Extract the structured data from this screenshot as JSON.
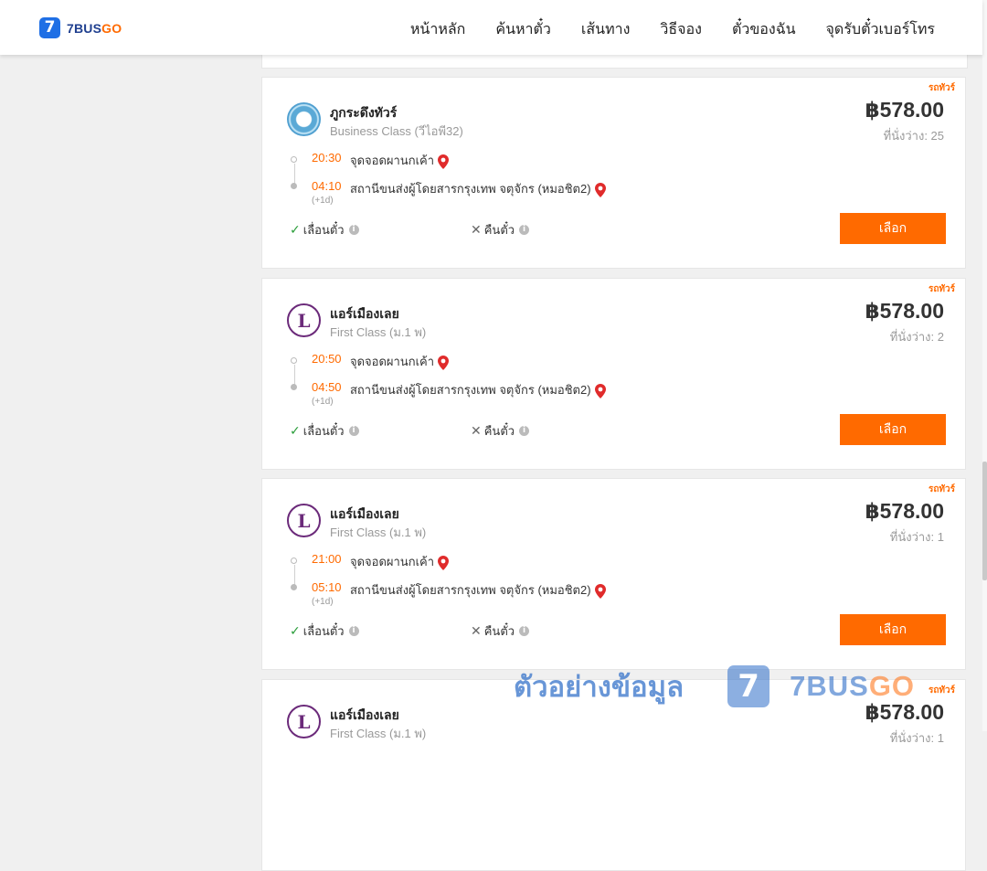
{
  "header": {
    "logo_digit": "7",
    "logo_text_a": "7BUS",
    "logo_text_b": "GO",
    "nav": [
      "หน้าหลัก",
      "ค้นหาตั๋ว",
      "เส้นทาง",
      "วิธีจอง",
      "ตั๋วของฉัน",
      "จุดรับตั๋วเบอร์โทร"
    ]
  },
  "trips": [
    {
      "tag": "รถทัวร์",
      "operator": "ภูกระดึงทัวร์",
      "class": "Business Class (วีไอพี32)",
      "logo_icon": "phukradueng-logo",
      "price": "฿578.00",
      "seats": "ที่นั่งว่าง: 25",
      "dep_time": "20:30",
      "dep_place": "จุดจอดผานกเค้า",
      "arr_time": "04:10",
      "arr_place": "สถานีขนส่งผู้โดยสารกรุงเทพ จตุจักร (หมอชิต2)",
      "next_day": "(+1d)",
      "change": "เลื่อนตั๋ว",
      "refund": "คืนตั๋ว",
      "button": "เลือก"
    },
    {
      "tag": "รถทัวร์",
      "operator": "แอร์เมืองเลย",
      "class": "First Class (ม.1 พ)",
      "logo_icon": "air-mueang-loei-logo",
      "price": "฿578.00",
      "seats": "ที่นั่งว่าง: 2",
      "dep_time": "20:50",
      "dep_place": "จุดจอดผานกเค้า",
      "arr_time": "04:50",
      "arr_place": "สถานีขนส่งผู้โดยสารกรุงเทพ จตุจักร (หมอชิต2)",
      "next_day": "(+1d)",
      "change": "เลื่อนตั๋ว",
      "refund": "คืนตั๋ว",
      "button": "เลือก"
    },
    {
      "tag": "รถทัวร์",
      "operator": "แอร์เมืองเลย",
      "class": "First Class (ม.1 พ)",
      "logo_icon": "air-mueang-loei-logo",
      "price": "฿578.00",
      "seats": "ที่นั่งว่าง: 1",
      "dep_time": "21:00",
      "dep_place": "จุดจอดผานกเค้า",
      "arr_time": "05:10",
      "arr_place": "สถานีขนส่งผู้โดยสารกรุงเทพ จตุจักร (หมอชิต2)",
      "next_day": "(+1d)",
      "change": "เลื่อนตั๋ว",
      "refund": "คืนตั๋ว",
      "button": "เลือก"
    },
    {
      "tag": "รถทัวร์",
      "operator": "แอร์เมืองเลย",
      "class": "First Class (ม.1 พ)",
      "logo_icon": "air-mueang-loei-logo",
      "price": "฿578.00",
      "seats": "ที่นั่งว่าง: 1",
      "dep_time": "",
      "dep_place": "",
      "arr_time": "",
      "arr_place": "",
      "next_day": "",
      "change": "",
      "refund": "",
      "button": ""
    }
  ],
  "watermark": {
    "text": "ตัวอย่างข้อมูล",
    "logo_digit": "7",
    "brand_a": "7BUS",
    "brand_b": "GO"
  },
  "colors": {
    "accent": "#ff6a00",
    "brand_blue": "#1f6fe5",
    "available": "#2a9d3a"
  }
}
